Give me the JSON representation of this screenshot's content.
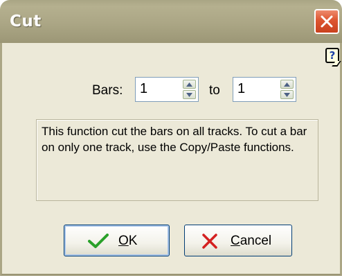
{
  "dialog": {
    "title": "Cut",
    "help_glyph": "?",
    "bars_label": "Bars:",
    "bars_from": "1",
    "to_label": "to",
    "bars_to": "1",
    "info_text": "This function cut the bars on all tracks. To cut a bar on only one track, use the Copy/Paste functions.",
    "ok_mnemonic": "O",
    "ok_rest": "K",
    "cancel_mnemonic": "C",
    "cancel_rest": "ancel"
  },
  "icons": {
    "close": "close-x-icon",
    "help": "help-question-icon",
    "ok": "green-check-icon",
    "cancel": "red-x-icon"
  },
  "colors": {
    "titlebar": "#aba685",
    "dialog_bg": "#ece9d8",
    "close_button": "#dd5530",
    "ok_check": "#2aa12a",
    "cancel_x": "#d42020"
  }
}
